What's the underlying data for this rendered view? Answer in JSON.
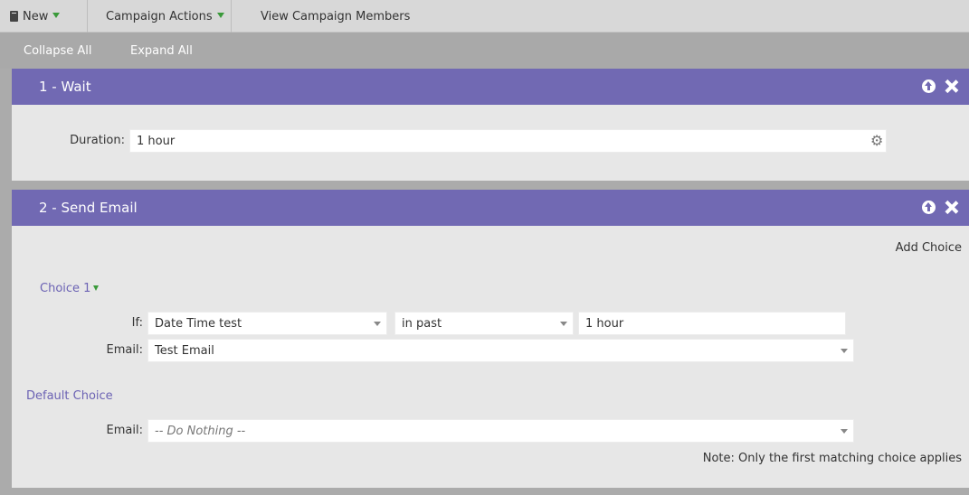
{
  "toolbar": {
    "new_label": "New",
    "campaign_actions_label": "Campaign Actions",
    "view_members_label": "View Campaign Members"
  },
  "subbar": {
    "collapse_all": "Collapse All",
    "expand_all": "Expand All"
  },
  "steps": [
    {
      "title": "1 - Wait",
      "duration_label": "Duration:",
      "duration_value": "1 hour"
    },
    {
      "title": "2 - Send Email",
      "add_choice": "Add Choice",
      "choice_label": "Choice 1",
      "if_label": "If:",
      "if_attribute": "Date Time test",
      "if_operator": "in past",
      "if_value": "1 hour",
      "email_label": "Email:",
      "email_value": "Test Email",
      "default_choice_label": "Default Choice",
      "default_email_label": "Email:",
      "default_email_value": "-- Do Nothing --",
      "note": "Note: Only the first matching choice applies"
    }
  ],
  "colors": {
    "header_purple": "#7169b3",
    "link_purple": "#6c63b4",
    "caret_green": "#3a9a3a"
  }
}
